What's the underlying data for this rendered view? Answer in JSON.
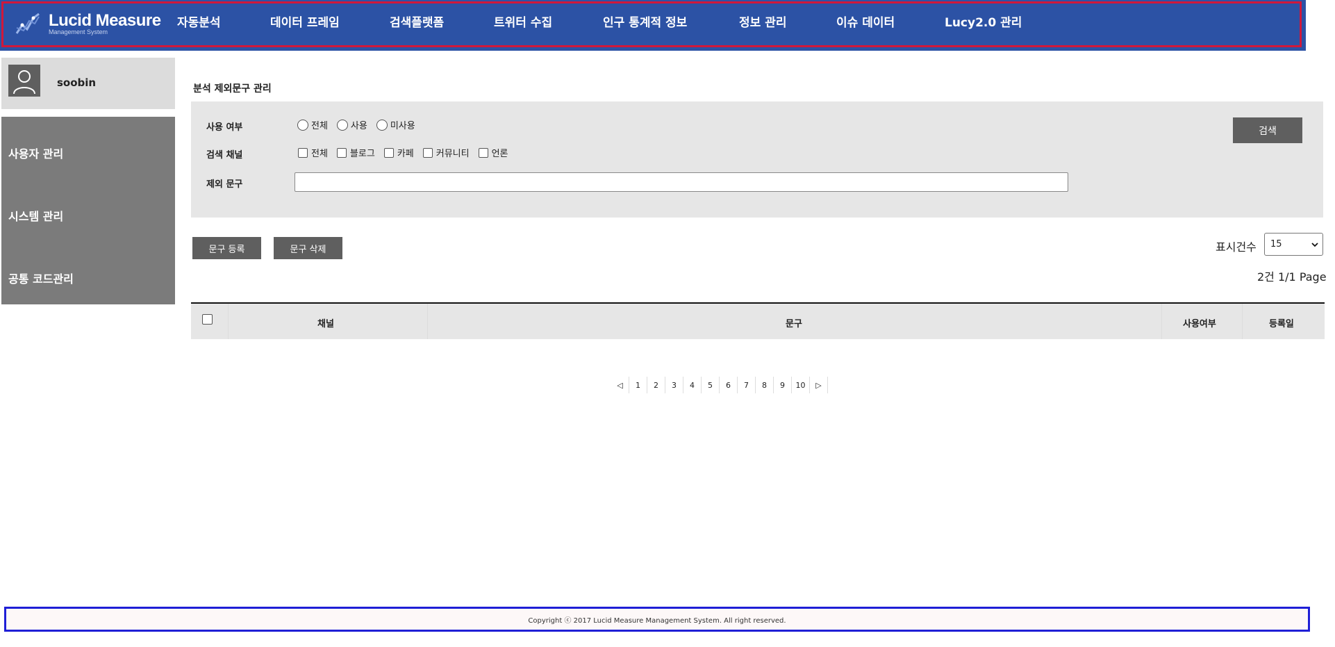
{
  "header": {
    "logo_title": "Lucid Measure",
    "logo_subtitle": "Management System",
    "nav": [
      "자동분석",
      "데이터 프레임",
      "검색플랫폼",
      "트위터 수집",
      "인구 통계적 정보",
      "정보 관리",
      "이슈 데이터",
      "Lucy2.0 관리"
    ]
  },
  "user": {
    "name": "soobin"
  },
  "sidebar": {
    "items": [
      "사용자 관리",
      "시스템 관리",
      "공통 코드관리"
    ]
  },
  "page": {
    "title": "분석 제외문구 관리"
  },
  "search": {
    "use_label": "사용 여부",
    "use_options": [
      "전체",
      "사용",
      "미사용"
    ],
    "channel_label": "검색 채널",
    "channel_options": [
      "전체",
      "블로그",
      "카페",
      "커뮤니티",
      "언론"
    ],
    "phrase_label": "제외 문구",
    "phrase_value": "",
    "button": "검색"
  },
  "actions": {
    "register": "문구 등록",
    "delete": "문구 삭제"
  },
  "display": {
    "label": "표시건수",
    "value": "15",
    "info": "2건 1/1 Page"
  },
  "table": {
    "headers": [
      "채널",
      "문구",
      "사용여부",
      "등록일"
    ]
  },
  "pagination": {
    "prev": "◁",
    "pages": [
      "1",
      "2",
      "3",
      "4",
      "5",
      "6",
      "7",
      "8",
      "9",
      "10"
    ],
    "next": "▷"
  },
  "footer": {
    "text": "Copyright ⓒ 2017 Lucid Measure Management System. All right reserved."
  },
  "colors": {
    "header_bg": "#2c52a5",
    "button_bg": "#5f5f5f",
    "sidebar_bg": "#7b7b7b"
  }
}
